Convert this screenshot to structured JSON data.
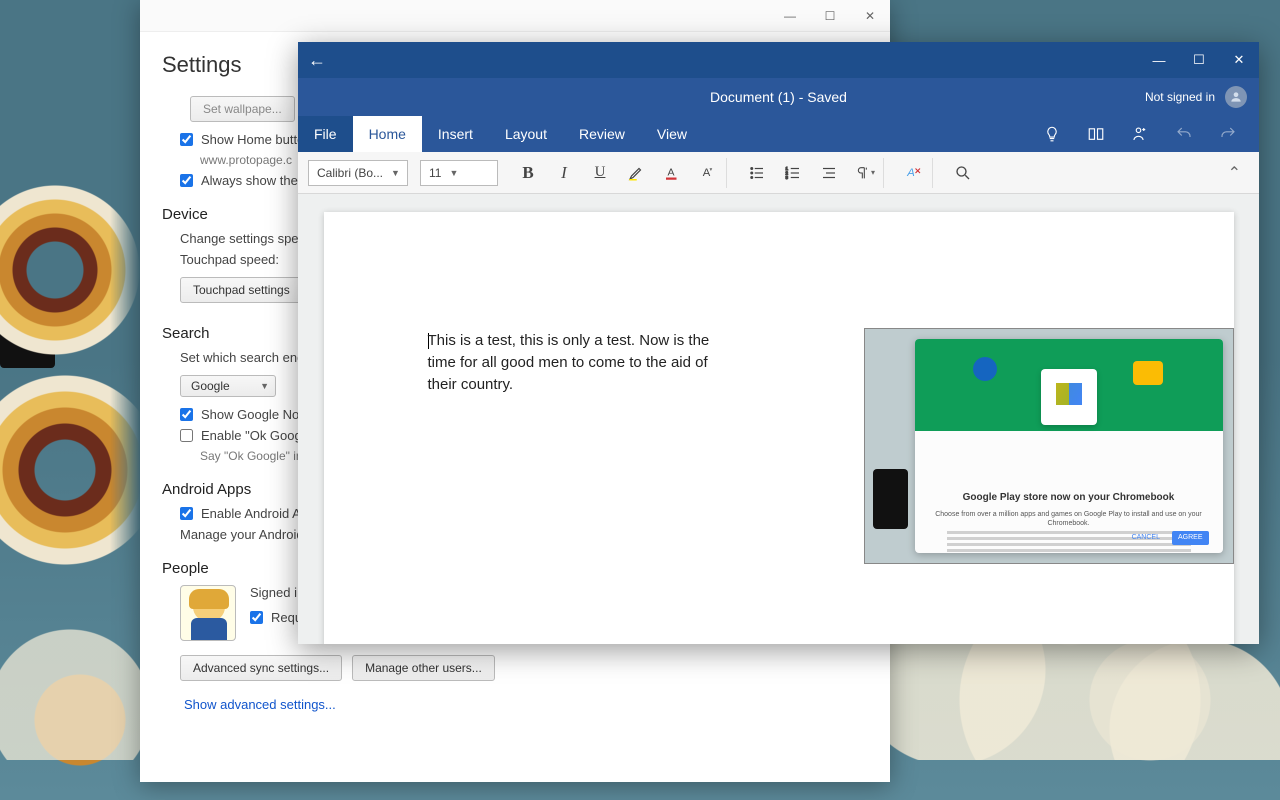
{
  "settings": {
    "title": "Settings",
    "show_home": "Show Home button",
    "home_url": "www.protopage.c",
    "always_show": "Always show the b",
    "device_h": "Device",
    "device_text": "Change settings specif",
    "touchpad_speed": "Touchpad speed:",
    "touchpad_btn": "Touchpad settings",
    "search_h": "Search",
    "search_text": "Set which search engin",
    "search_engine": "Google",
    "show_now": "Show Google Now",
    "enable_ok": "Enable \"Ok Google",
    "ok_hint": "Say \"Ok Google\" in",
    "android_h": "Android Apps",
    "enable_android": "Enable Android Ap",
    "manage_android": "Manage your Android",
    "people_h": "People",
    "signed_in": "Signed i",
    "require_pw": "Require password to wake from sleep",
    "adv_sync": "Advanced sync settings...",
    "manage_users": "Manage other users...",
    "show_advanced": "Show advanced settings..."
  },
  "word": {
    "doc_title": "Document (1)  -  Saved",
    "not_signed": "Not signed in",
    "tabs": {
      "file": "File",
      "home": "Home",
      "insert": "Insert",
      "layout": "Layout",
      "review": "Review",
      "view": "View"
    },
    "font_name": "Calibri (Bo...",
    "font_size": "11",
    "body_text": "This is a test, this is only a test. Now is the time for all good men to come to the aid of their country.",
    "play_title": "Google Play store now on your Chromebook",
    "play_sub": "Choose from over a million apps and games on Google Play to install and use on your Chromebook.",
    "cancel": "CANCEL",
    "agree": "AGREE"
  }
}
